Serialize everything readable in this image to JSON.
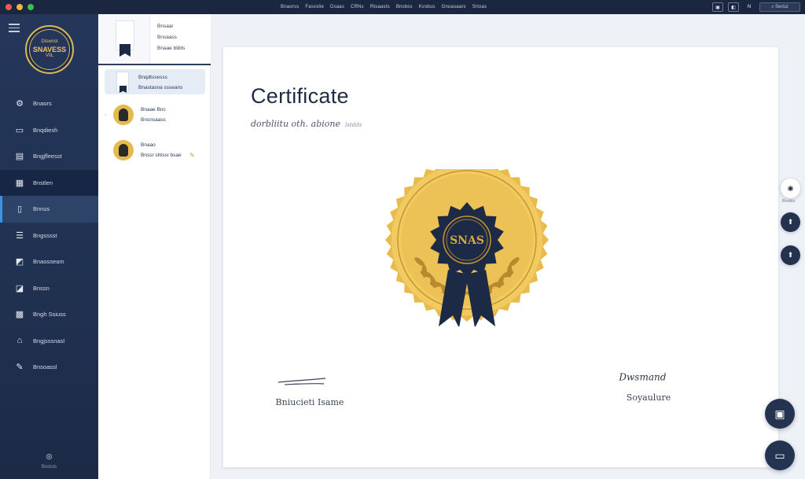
{
  "titlebar": {
    "menu": [
      "Bnaorss",
      "Fasvslie",
      "Dsaas",
      "CRNs",
      "Rtsaasts",
      "Bnsbss",
      "Kvsbus",
      "Gnuasaars",
      "Srtoas"
    ],
    "tools": [
      "▣",
      "◧",
      "N"
    ],
    "search": "⌕ Serisz"
  },
  "sidebar": {
    "logo": {
      "top": "Dtswnst",
      "mid": "SNAVESS",
      "bottom": "VIlL"
    },
    "items": [
      {
        "icon": "⚙",
        "label": "Bnaors"
      },
      {
        "icon": "▭",
        "label": "Bnqdiesh"
      },
      {
        "icon": "▤",
        "label": "Bngjfleesst"
      },
      {
        "icon": "▦",
        "label": "Bnstlen"
      },
      {
        "icon": "▯",
        "label": "Bnnus"
      },
      {
        "icon": "☰",
        "label": "Bngsssst"
      },
      {
        "icon": "◩",
        "label": "Bnaosseam"
      },
      {
        "icon": "◪",
        "label": "Bnssn"
      },
      {
        "icon": "▩",
        "label": "Bngh Ssiuss"
      },
      {
        "icon": "⌂",
        "label": "Bngjsssnasl"
      },
      {
        "icon": "✎",
        "label": "Bnsoassl"
      }
    ],
    "footer": {
      "icon": "⊛",
      "label": "Bnslsts"
    }
  },
  "panel": {
    "preview": {
      "lines": [
        "Bnsaar",
        "Bnsaass",
        "Bnaae blibls"
      ]
    },
    "selected_doc": {
      "lines": [
        "Bnqdtssesss",
        "Bnastasna ssseans"
      ]
    },
    "people": [
      {
        "name": "Bnaae Bnc",
        "sub": "Bnsnsaass"
      },
      {
        "name": "Bnaao",
        "sub": "Bnssr shtssr bsae"
      }
    ]
  },
  "certificate": {
    "title": "Certificate",
    "subtitle": "dorbliitu oth. abione",
    "subtitle_small": "lstdds",
    "seal_text": "SNAS",
    "left_signature": "Bniucieti Isame",
    "right_signature": "Soyaulure",
    "signature_script": "Dwsmand"
  },
  "controls": {
    "right": [
      {
        "icon": "◉",
        "label": "Bnslsts"
      },
      {
        "icon": "⬆",
        "label": ""
      },
      {
        "icon": "⬆",
        "label": ""
      }
    ],
    "fabs": [
      "▣",
      "▭"
    ]
  },
  "colors": {
    "sidebar": "#22345a",
    "gold": "#e7b94a",
    "navy": "#1d2a45",
    "accent": "#3a93e6"
  }
}
